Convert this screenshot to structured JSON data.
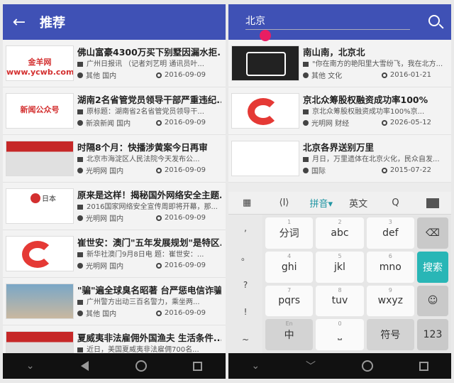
{
  "left": {
    "title": "推荐",
    "items": [
      {
        "title": "佛山富豪4300万买下别墅因漏水拒...",
        "summary": "广州日报讯 （记者刘艺明 通讯员叶...",
        "source": "其他 国内",
        "date": "2016-09-09",
        "thumb": "金羊网 www.ycwb.com"
      },
      {
        "title": "湖南2名省管党员领导干部严重违纪...",
        "summary": "原标题：湖南省2名省管党员领导干...",
        "source": "新浪新闻 国内",
        "date": "2016-09-09",
        "thumb": "新闻公众号"
      },
      {
        "title": "时隔8个月：快播涉黄案今日再审",
        "summary": "北京市海淀区人民法院今天发布公...",
        "source": "光明网 国内",
        "date": "2016-09-09",
        "thumb": ""
      },
      {
        "title": "原来是这样！揭秘国外网络安全主题...",
        "summary": "2016国家网络安全宣传周即将开幕，那...",
        "source": "光明网 国内",
        "date": "2016-09-09",
        "thumb": "日本"
      },
      {
        "title": "崔世安：澳门\"五年发展规划\"是特区...",
        "summary": "新华社澳门9月8日电 题：崔世安：...",
        "source": "光明网 国内",
        "date": "2016-09-09",
        "thumb": ""
      },
      {
        "title": "\"骗\"遍全球臭名昭著 台严惩电信诈骗...",
        "summary": "广州警方出动三百名警力，乘坐两...",
        "source": "其他 国内",
        "date": "2016-09-09",
        "thumb": ""
      },
      {
        "title": "夏威夷非法雇佣外国渔夫 生活条件...",
        "summary": "近日，美国夏威夷非法雇佣700名...",
        "source": "",
        "date": "",
        "thumb": ""
      }
    ]
  },
  "right": {
    "search_value": "北京",
    "items": [
      {
        "title": "南山南，北京北",
        "summary": "\"你在南方的艳阳里大雪纷飞，我在北方...",
        "source": "其他 文化",
        "date": "2016-01-21"
      },
      {
        "title": "京北众筹股权融资成功率100%",
        "summary": "京北众筹股权融资成功率100%京...",
        "source": "光明网 财经",
        "date": "2026-05-12"
      },
      {
        "title": "北京各界送别万里",
        "summary": "月日，万里遗体在北京火化，民众自发...",
        "source": "国际",
        "date": "2015-07-22"
      }
    ],
    "keyboard": {
      "toolbar": [
        "▦",
        "⟨I⟩",
        "拼音▾",
        "英文",
        "Q",
        ""
      ],
      "side": [
        ",",
        "。",
        "?",
        "!",
        "~"
      ],
      "keys": [
        {
          "n": "1",
          "l": "分词"
        },
        {
          "n": "2",
          "l": "abc"
        },
        {
          "n": "3",
          "l": "def"
        },
        {
          "n": "",
          "l": "⌫"
        },
        {
          "n": "4",
          "l": "ghi"
        },
        {
          "n": "5",
          "l": "jkl"
        },
        {
          "n": "6",
          "l": "mno"
        },
        {
          "n": "",
          "l": "搜索"
        },
        {
          "n": "7",
          "l": "pqrs"
        },
        {
          "n": "8",
          "l": "tuv"
        },
        {
          "n": "9",
          "l": "wxyz"
        },
        {
          "n": "",
          "l": "☺"
        },
        {
          "n": "En",
          "l": "中"
        },
        {
          "n": "0",
          "l": "⎵"
        },
        {
          "n": "",
          "l": "符号"
        },
        {
          "n": "",
          "l": "123"
        }
      ]
    }
  },
  "colors": {
    "appbar": "#3f51b5",
    "accent": "#e91e63",
    "search_key": "#29b6b6"
  }
}
